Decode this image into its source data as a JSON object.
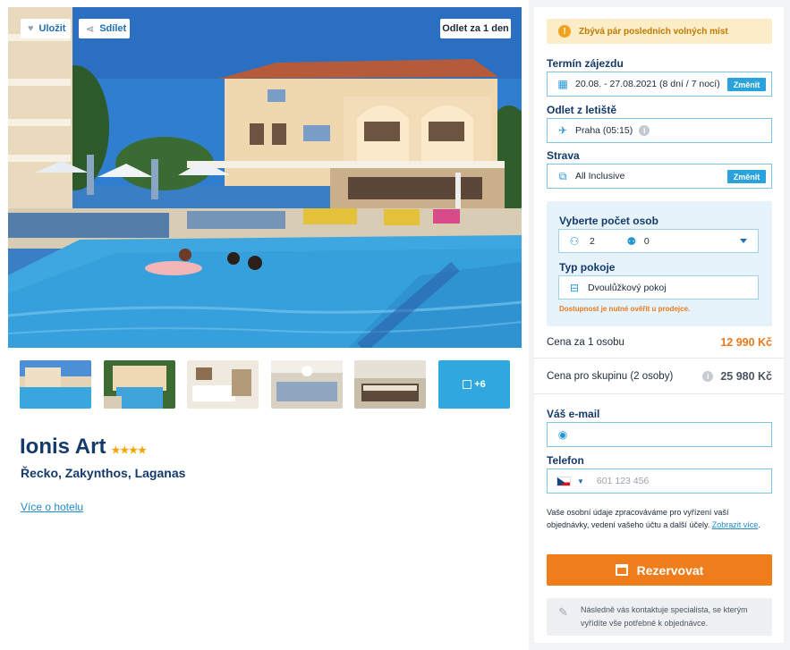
{
  "hero": {
    "save_label": "Uložit",
    "share_label": "Sdílet",
    "departure_label": "Odlet za 1 den"
  },
  "gallery": {
    "more_label": "+6"
  },
  "hotel": {
    "name": "Ionis Art",
    "stars": "★★★★",
    "location": "Řecko, Zakynthos, Laganas",
    "more_link": "Více o hotelu"
  },
  "booking": {
    "warning": "Zbývá pár posledních volných míst",
    "term": {
      "label": "Termín zájezdu",
      "value": "20.08. - 27.08.2021 (8 dní / 7 nocí)",
      "change": "Změnit"
    },
    "departure": {
      "label": "Odlet z letiště",
      "value": "Praha (05:15)"
    },
    "board": {
      "label": "Strava",
      "value": "All Inclusive",
      "change": "Změnit"
    },
    "persons": {
      "label": "Vyberte počet osob",
      "adults": "2",
      "children": "0",
      "room_label": "Typ pokoje",
      "room_value": "Dvoulůžkový pokoj",
      "availability": "Dostupnost je nutné ověřit u prodejce."
    },
    "price_per_person_label": "Cena za 1 osobu",
    "price_per_person": "12 990 Kč",
    "price_group_label": "Cena pro skupinu (2 osoby)",
    "price_group": "25 980 Kč",
    "email_label": "Váš e-mail",
    "email_value": "",
    "phone_label": "Telefon",
    "phone_placeholder": "601 123 456",
    "consent_text": "Vaše osobní údaje zpracováváme pro vyřízení vaší objednávky, vedení vašeho účtu a další účely. ",
    "consent_link": "Zobrazit více",
    "consent_end": ".",
    "reserve_label": "Rezervovat",
    "contact_note": "Následně vás kontaktuje specialista, se kterým vyřídíte vše potřebné k objednávce."
  },
  "colors": {
    "accent_orange": "#ef7d1b",
    "accent_blue": "#2aa3dc",
    "title_navy": "#143a6b"
  }
}
